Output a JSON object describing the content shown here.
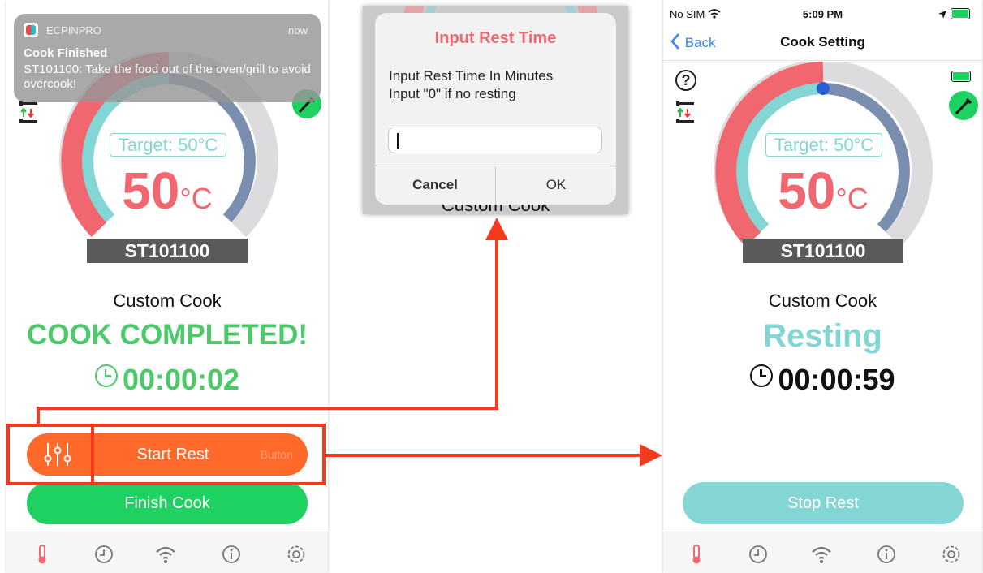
{
  "left": {
    "notification": {
      "app_name": "ECPINPRO",
      "time": "now",
      "title": "Cook Finished",
      "body": "ST101100: Take the food out of the oven/grill to avoid overcook!"
    },
    "gauge": {
      "target_label": "Target: 50°C",
      "temp_value": "50",
      "temp_unit": "°C",
      "probe_id": "ST101100",
      "fill_fraction": 1.0
    },
    "cook_name": "Custom Cook",
    "status": "COOK COMPLETED!",
    "timer": "00:00:02",
    "start_rest_label": "Start Rest",
    "start_rest_suffix": "Button",
    "finish_cook_label": "Finish Cook"
  },
  "dialog": {
    "title": "Input Rest Time",
    "message_line1": "Input Rest Time In Minutes",
    "message_line2": "Input \"0\" if no resting",
    "input_value": "",
    "cancel_label": "Cancel",
    "ok_label": "OK",
    "behind_text": "Custom Cook"
  },
  "right": {
    "status_bar": {
      "carrier": "No SIM",
      "time": "5:09 PM"
    },
    "nav": {
      "back_label": "Back",
      "title": "Cook Setting"
    },
    "gauge": {
      "target_label": "Target: 50°C",
      "temp_value": "50",
      "temp_unit": "°C",
      "probe_id": "ST101100",
      "fill_fraction": 1.0
    },
    "cook_name": "Custom Cook",
    "status": "Resting",
    "timer": "00:00:59",
    "stop_rest_label": "Stop Rest"
  },
  "colors": {
    "accent_red": "#f0676f",
    "teal": "#84d6d5",
    "slate": "#7a8fb0",
    "track": "#dcdcdf",
    "green": "#1fd160",
    "orange": "#ff6a2a",
    "complete_green": "#4cca6a",
    "annotation_red": "#f23a1f"
  }
}
